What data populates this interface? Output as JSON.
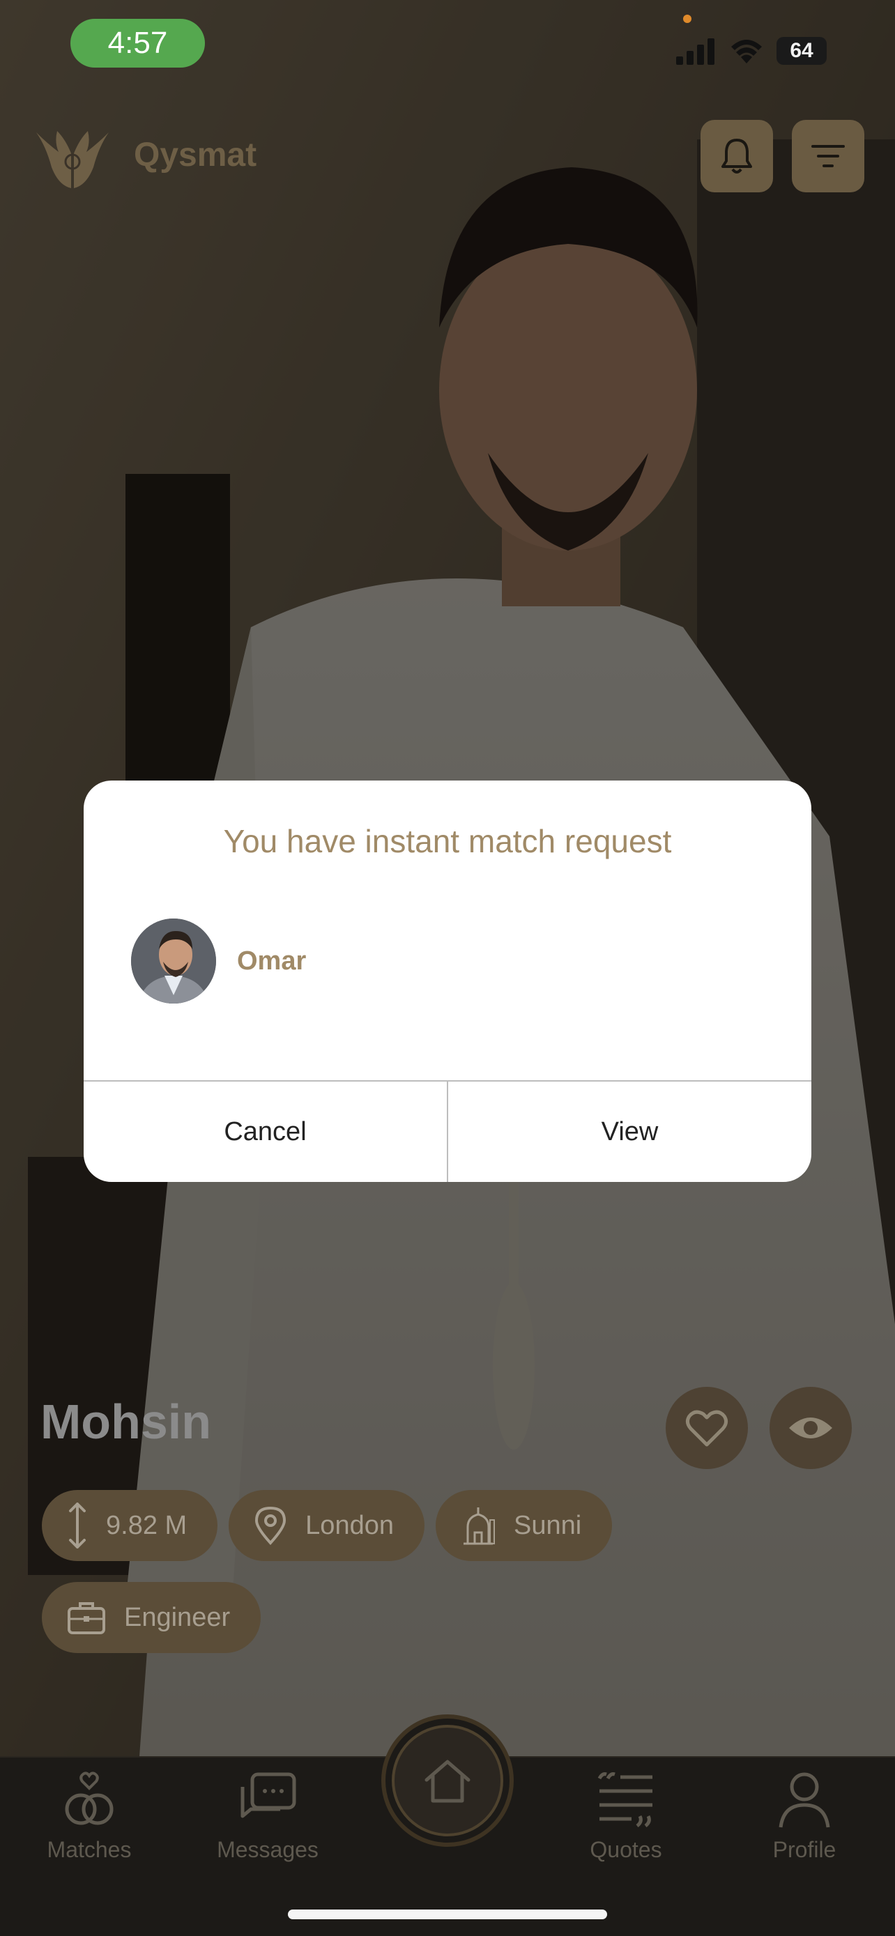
{
  "status_bar": {
    "time": "4:57",
    "battery": "64"
  },
  "header": {
    "app_name": "Qysmat"
  },
  "profile": {
    "name": "Mohsin",
    "details": [
      {
        "icon": "height-icon",
        "label": "9.82 M"
      },
      {
        "icon": "location-pin-icon",
        "label": "London"
      },
      {
        "icon": "mosque-icon",
        "label": "Sunni"
      }
    ],
    "occupation": "Engineer"
  },
  "dialog": {
    "title": "You have instant match request",
    "requester_name": "Omar",
    "cancel_label": "Cancel",
    "view_label": "View"
  },
  "nav": {
    "matches": "Matches",
    "messages": "Messages",
    "quotes": "Quotes",
    "profile": "Profile"
  },
  "colors": {
    "accent": "#a08a67",
    "chip": "#5b4d38",
    "status_green": "#55a84f"
  }
}
